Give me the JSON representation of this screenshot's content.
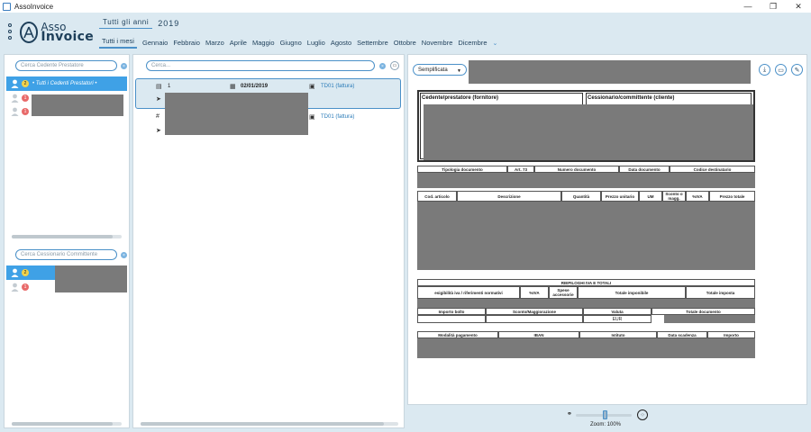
{
  "window": {
    "title": "AssoInvoice",
    "minimize": "—",
    "maximize": "❐",
    "close": "✕"
  },
  "logo": {
    "line1": "Asso",
    "line2": "Invoice"
  },
  "header": {
    "year_all_label": "Tutti gli anni",
    "year_value": "2019",
    "months": [
      "Tutti i mesi",
      "Gennaio",
      "Febbraio",
      "Marzo",
      "Aprile",
      "Maggio",
      "Giugno",
      "Luglio",
      "Agosto",
      "Settembre",
      "Ottobre",
      "Novembre",
      "Dicembre"
    ],
    "active_month": "Tutti i mesi"
  },
  "cedenti": {
    "search_placeholder": "Cerca Cedente Prestatore",
    "items": [
      {
        "label": "• Tutti i Cedenti Prestatori •",
        "badge": "2",
        "badge_color": "#f2d24a"
      },
      {
        "label": "",
        "badge": "1",
        "badge_color": "#e86a6a"
      },
      {
        "label": "",
        "badge": "1",
        "badge_color": "#e86a6a"
      }
    ]
  },
  "cessionari": {
    "search_placeholder": "Cerca Cessionario Committente",
    "items": [
      {
        "badge": "2",
        "badge_color": "#f2d24a"
      },
      {
        "badge": "1",
        "badge_color": "#e86a6a"
      }
    ]
  },
  "documents": {
    "search_placeholder": "Cerca...",
    "items": [
      {
        "number": "1",
        "date": "02/01/2019",
        "type": "TD01 (fattura)"
      },
      {
        "number": "",
        "date": "",
        "type": "TD01 (fattura)"
      }
    ]
  },
  "viewer": {
    "mode": "Semplificata",
    "accent": "#4a90c8",
    "cedente_title": "Cedente/prestatore (fornitore)",
    "cessionario_title": "Cessionario/committente (cliente)",
    "doc_table_headers": [
      "Tipologia documento",
      "Art. 73",
      "Numero documento",
      "Data documento",
      "Codice destinatario"
    ],
    "lines_headers": [
      "Cod. articolo",
      "Descrizione",
      "Quantità",
      "Prezzo unitario",
      "UM",
      "Sconto o magg.",
      "%IVA",
      "Prezzo totale"
    ],
    "riepilogo_title": "RIEPILOGHI IVA E TOTALI",
    "riepilogo_headers": [
      "esigibilità iva / riferimenti normativi",
      "%IVA",
      "Spese accessorie",
      "Totale imponibile",
      "Totale imposta"
    ],
    "totals_headers": [
      "Importo bollo",
      "Sconto/Maggiorazione",
      "Valuta",
      "Totale documento"
    ],
    "currency": "EUR",
    "payment_headers": [
      "Modalità pagamento",
      "IBAN",
      "Istituto",
      "Data scadenza",
      "Importo"
    ]
  },
  "zoom": {
    "label": "Zoom: 100%",
    "level_percent": 100
  }
}
